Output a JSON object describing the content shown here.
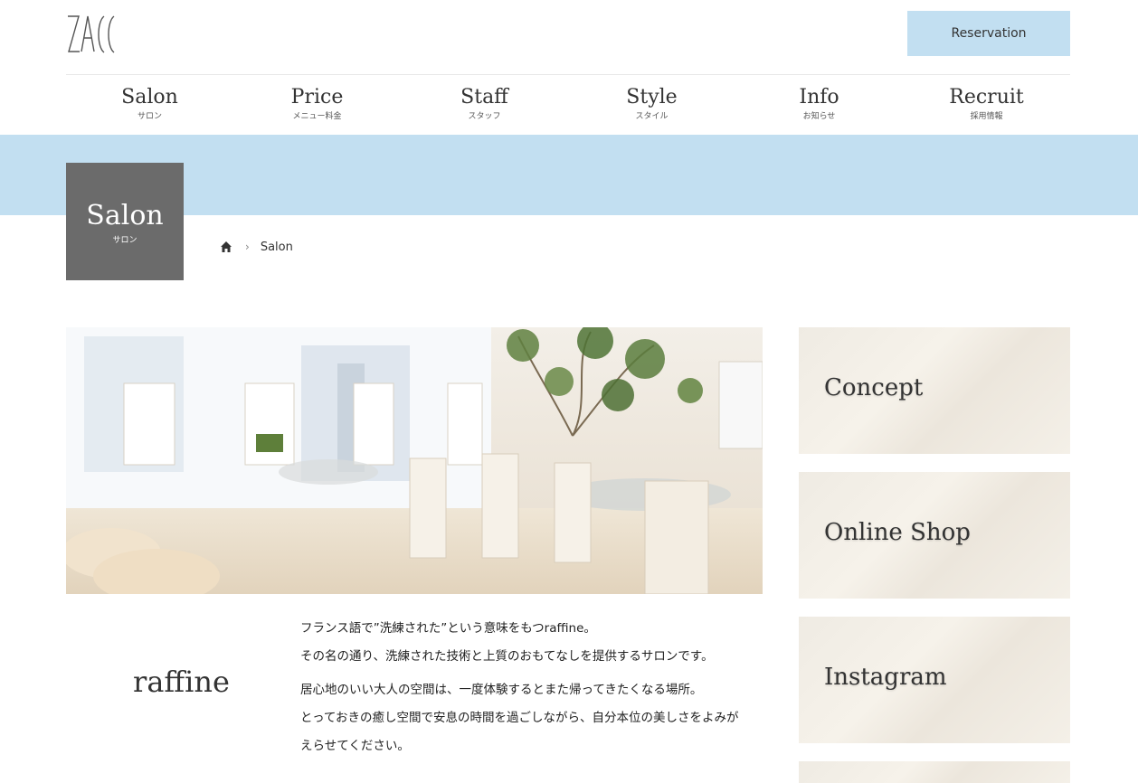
{
  "header": {
    "logo_text": "ZACC",
    "reservation_label": "Reservation"
  },
  "nav": [
    {
      "en": "Salon",
      "ja": "サロン"
    },
    {
      "en": "Price",
      "ja": "メニュー料金"
    },
    {
      "en": "Staff",
      "ja": "スタッフ"
    },
    {
      "en": "Style",
      "ja": "スタイル"
    },
    {
      "en": "Info",
      "ja": "お知らせ"
    },
    {
      "en": "Recruit",
      "ja": "採用情報"
    }
  ],
  "page": {
    "title_en": "Salon",
    "title_ja": "サロン",
    "breadcrumb_current": "Salon"
  },
  "content": {
    "subtitle": "raffine",
    "paragraphs": [
      "フランス語で”洗練された”という意味をもつraffine。",
      "その名の通り、洗練された技術と上質のおもてなしを提供するサロンです。",
      "居心地のいい大人の空間は、一度体験するとまた帰ってきたくなる場所。",
      "とっておきの癒し空間で安息の時間を過ごしながら、自分本位の美しさをよみが",
      "えらせてください。"
    ]
  },
  "sidebar": [
    {
      "label": "Concept"
    },
    {
      "label": "Online Shop"
    },
    {
      "label": "Instagram"
    }
  ],
  "colors": {
    "accent_band": "#c2dff1",
    "title_box": "#6b6b6b",
    "card_bg": "#f2eee6"
  },
  "icons": {
    "home": "home-icon",
    "breadcrumb_separator": "chevron-right-icon"
  }
}
